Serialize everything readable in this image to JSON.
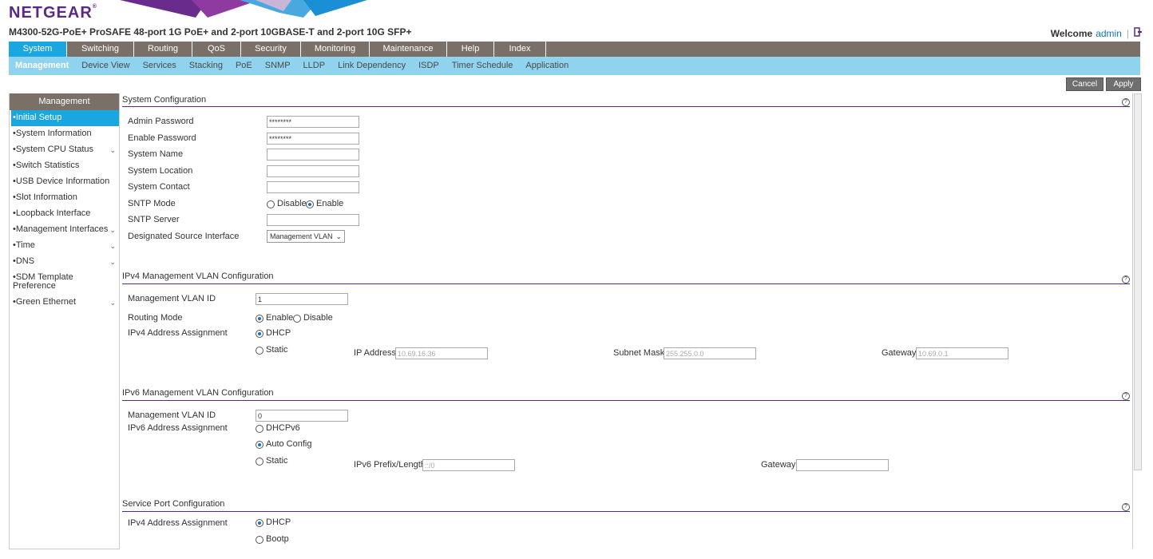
{
  "header": {
    "logo": "NETGEAR",
    "logo_mark": "®",
    "model": "M4300-52G-PoE+ ProSAFE 48-port 1G PoE+ and 2-port 10GBASE-T and 2-port 10G SFP+",
    "welcome_label": "Welcome",
    "user": "admin",
    "separator": "|"
  },
  "main_tabs": [
    "System",
    "Switching",
    "Routing",
    "QoS",
    "Security",
    "Monitoring",
    "Maintenance",
    "Help",
    "Index"
  ],
  "sub_tabs": [
    "Management",
    "Device View",
    "Services",
    "Stacking",
    "PoE",
    "SNMP",
    "LLDP",
    "Link Dependency",
    "ISDP",
    "Timer Schedule",
    "Application"
  ],
  "buttons": {
    "cancel": "Cancel",
    "apply": "Apply"
  },
  "sidebar": {
    "title": "Management",
    "items": [
      "Initial Setup",
      "System Information",
      "System CPU Status",
      "Switch Statistics",
      "USB Device Information",
      "Slot Information",
      "Loopback Interface",
      "Management Interfaces",
      "Time",
      "DNS",
      "SDM Template Preference",
      "Green Ethernet"
    ],
    "bullet": "•",
    "chevron": "⌄"
  },
  "system_config": {
    "title": "System Configuration",
    "help": "?",
    "admin_password_label": "Admin Password",
    "admin_password_value": "********",
    "enable_password_label": "Enable Password",
    "enable_password_value": "********",
    "system_name_label": "System Name",
    "system_location_label": "System Location",
    "system_contact_label": "System Contact",
    "sntp_mode_label": "SNTP Mode",
    "sntp_disable": "Disable",
    "sntp_enable": "Enable",
    "sntp_server_label": "SNTP Server",
    "dsi_label": "Designated Source Interface",
    "dsi_value": "Management VLAN"
  },
  "ipv4": {
    "title": "IPv4 Management VLAN Configuration",
    "vlan_id_label": "Management VLAN ID",
    "vlan_id_value": "1",
    "routing_mode_label": "Routing Mode",
    "routing_enable": "Enable",
    "routing_disable": "Disable",
    "addr_label": "IPv4 Address Assignment",
    "dhcp": "DHCP",
    "static": "Static",
    "ip_label": "IP Address",
    "ip_value": "10.69.16.36",
    "mask_label": "Subnet Mask",
    "mask_value": "255.255.0.0",
    "gateway_label": "Gateway",
    "gateway_value": "10.69.0.1"
  },
  "ipv6": {
    "title": "IPv6 Management VLAN Configuration",
    "vlan_id_label": "Management VLAN ID",
    "vlan_id_value": "0",
    "addr_label": "IPv6 Address Assignment",
    "dhcpv6": "DHCPv6",
    "auto": "Auto Config",
    "static": "Static",
    "prefix_label": "IPv6 Prefix/Length",
    "prefix_value": "::/0",
    "gateway_label": "Gateway"
  },
  "service_port": {
    "title": "Service Port Configuration",
    "addr_label": "IPv4 Address Assignment",
    "dhcp": "DHCP",
    "bootp": "Bootp"
  },
  "colors": {
    "brand": "#5a2a82",
    "accent": "#1aa6de",
    "nav": "#7a7068",
    "subnav": "#8fd3ee"
  }
}
